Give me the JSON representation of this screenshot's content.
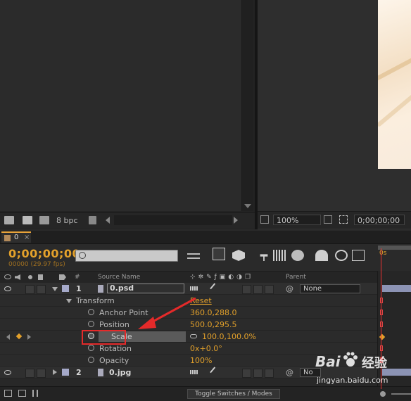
{
  "project_panel": {
    "bpc": "8 bpc"
  },
  "comp_panel": {
    "zoom": "100%",
    "timecode": "0;00;00;00"
  },
  "timeline": {
    "tab_label": "0",
    "timecode": "0;00;00;00",
    "fps": "00000 (29.97 fps)",
    "columns": {
      "number": "#",
      "source_name": "Source Name",
      "parent": "Parent"
    },
    "layers": [
      {
        "number": "1",
        "name": "0.psd",
        "parent": "None"
      },
      {
        "number": "2",
        "name": "0.jpg",
        "parent": "No"
      }
    ],
    "transform": {
      "label": "Transform",
      "reset": "Reset",
      "properties": [
        {
          "name": "Anchor Point",
          "value": "360.0,288.0"
        },
        {
          "name": "Position",
          "value": "500.0,295.5"
        },
        {
          "name": "Scale",
          "value": "100.0,100.0%"
        },
        {
          "name": "Rotation",
          "value": "0x+0.0°"
        },
        {
          "name": "Opacity",
          "value": "100%"
        }
      ]
    },
    "toggle_button": "Toggle Switches / Modes",
    "ruler_start": "0s"
  },
  "watermark": {
    "brand": "Bai",
    "brand_cn": "经验",
    "url": "jingyan.baidu.com"
  },
  "colors": {
    "accent": "#e3a12b",
    "highlight": "#e42a2a",
    "label": "#a5a9c9"
  }
}
